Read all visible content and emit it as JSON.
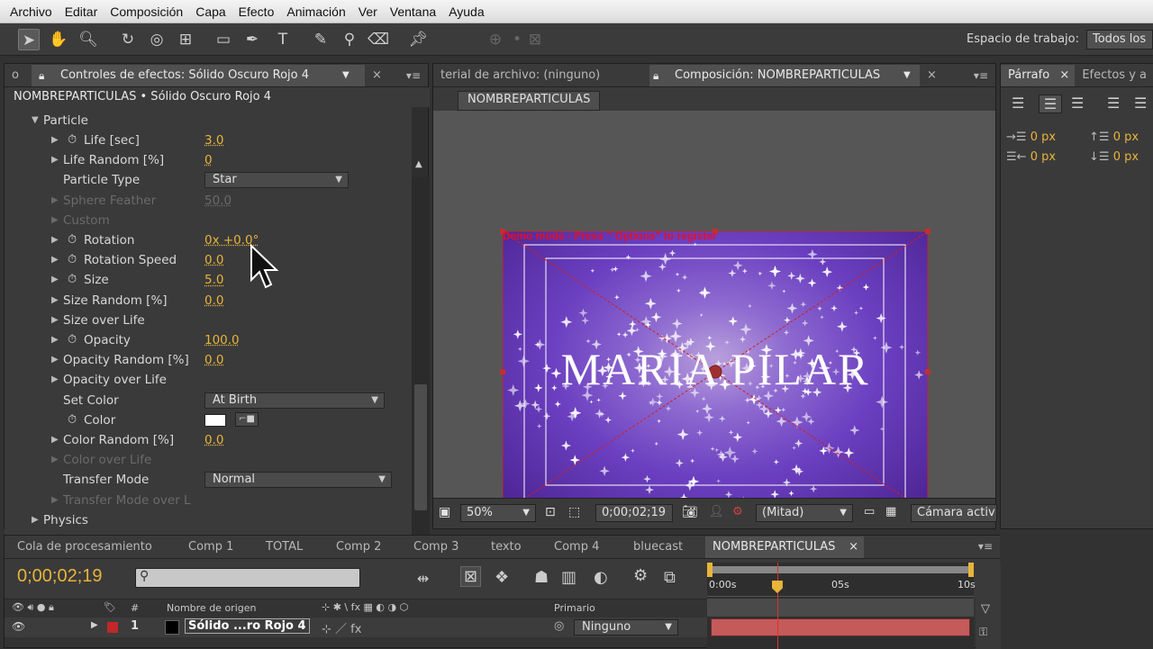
{
  "menubar": {
    "items": [
      "Archivo",
      "Editar",
      "Composición",
      "Capa",
      "Efecto",
      "Animación",
      "Ver",
      "Ventana",
      "Ayuda"
    ]
  },
  "toolbar": {
    "tools": [
      "selection-tool",
      "hand-tool",
      "zoom-tool",
      "rotate-tool",
      "orbit-camera-tool",
      "pan-behind-tool",
      "rectangle-tool",
      "pen-tool",
      "text-tool",
      "brush-tool",
      "clone-stamp-tool",
      "eraser-tool",
      "puppet-pin-tool"
    ],
    "workspace_label": "Espacio de trabajo:",
    "workspace_value": "Todos los"
  },
  "effect_controls": {
    "tab_left_fragment": "o",
    "tab_label": "Controles de efectos: Sólido Oscuro Rojo 4",
    "header": "NOMBREPARTICULAS • Sólido Oscuro Rojo 4",
    "section_particle": "Particle",
    "section_physics": "Physics",
    "rows": [
      {
        "label": "Life [sec]",
        "value": "3.0"
      },
      {
        "label": "Life Random [%]",
        "value": "0"
      },
      {
        "label": "Particle Type",
        "value": "Star"
      },
      {
        "label": "Sphere Feather",
        "value": "50.0"
      },
      {
        "label": "Custom",
        "value": ""
      },
      {
        "label": "Rotation",
        "value": "0x +0.0°"
      },
      {
        "label": "Rotation Speed",
        "value": "0.0"
      },
      {
        "label": "Size",
        "value": "5.0"
      },
      {
        "label": "Size Random [%]",
        "value": "0.0"
      },
      {
        "label": "Size over Life",
        "value": ""
      },
      {
        "label": "Opacity",
        "value": "100.0"
      },
      {
        "label": "Opacity Random [%]",
        "value": "0.0"
      },
      {
        "label": "Opacity over Life",
        "value": ""
      },
      {
        "label": "Set Color",
        "value": "At Birth"
      },
      {
        "label": "Color",
        "value": ""
      },
      {
        "label": "Color Random [%]",
        "value": "0.0"
      },
      {
        "label": "Color over Life",
        "value": ""
      },
      {
        "label": "Transfer Mode",
        "value": "Normal"
      },
      {
        "label": "Transfer Mode over L",
        "value": ""
      }
    ],
    "color_swatch": "#ffffff"
  },
  "composition": {
    "tab_footage": "terial de archivo: (ninguno)",
    "tab_comp": "Composición: NOMBREPARTICULAS",
    "comp_button": "NOMBREPARTICULAS",
    "demo_text": "Demo mode - Press \" Options\" to register",
    "big_text": "MARIA PILAR",
    "zoom": "50%",
    "timecode": "0;00;02;19",
    "resolution": "(Mitad)",
    "camera": "Cámara activ"
  },
  "right_panel": {
    "tab_paragraph": "Párrafo",
    "tab_effects": "Efectos y a",
    "indent_values": [
      "0 px",
      "0 px",
      "0 px",
      "0 px"
    ]
  },
  "timeline": {
    "tabs": [
      "Cola de procesamiento",
      "Comp 1",
      "TOTAL",
      "Comp 2",
      "Comp 3",
      "texto",
      "Comp 4",
      "bluecast",
      "NOMBREPARTICULAS"
    ],
    "timecode": "0;00;02;19",
    "search_placeholder": "",
    "header_source": "Nombre de origen",
    "header_parent": "Primario",
    "layer_number": "1",
    "layer_name": "Sólido ...ro Rojo 4",
    "layer_parent": "Ninguno",
    "ruler": [
      "0:00s",
      "05s",
      "10s"
    ],
    "playhead_fraction": 0.2633
  },
  "colors": {
    "accent_orange": "#e8b43a",
    "layer_bar": "#c45a5a",
    "label_red": "#c0282a"
  }
}
